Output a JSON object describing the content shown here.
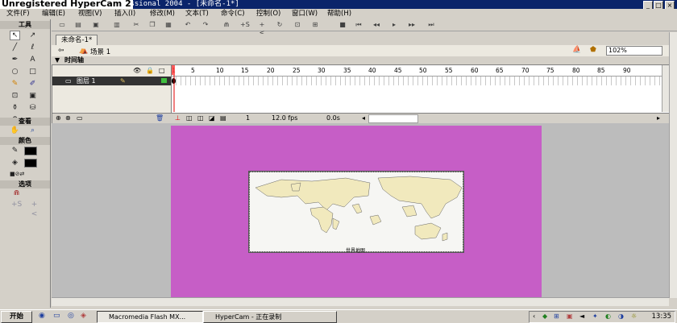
{
  "watermark": "Unregistered HyperCam 2",
  "window": {
    "title": "Macromedia Flash MX Professional 2004 - [未命名-1*]",
    "minimize": "_",
    "maximize": "□",
    "close": "×"
  },
  "menu": [
    "文件(F)",
    "编辑(E)",
    "视图(V)",
    "插入(I)",
    "修改(M)",
    "文本(T)",
    "命令(C)",
    "控制(O)",
    "窗口(W)",
    "帮助(H)"
  ],
  "tools": {
    "header": "工具",
    "view_header": "查看",
    "colors_header": "颜色",
    "options_header": "选项"
  },
  "document": {
    "tab": "未命名-1*",
    "scene": "场景 1",
    "zoom": "102%"
  },
  "timeline": {
    "header": "时间轴",
    "layer_name": "图层 1",
    "frame_numbers": [
      "1",
      "5",
      "10",
      "15",
      "20",
      "25",
      "30",
      "35",
      "40",
      "45",
      "50",
      "55",
      "60",
      "65",
      "70",
      "75",
      "80",
      "85",
      "90"
    ],
    "current_frame": "1",
    "frame_rate": "12.0 fps",
    "elapsed": "0.0s"
  },
  "stage": {
    "map_caption": "世界地图",
    "stage_color": "#c65ec6"
  },
  "taskbar": {
    "start": "开始",
    "tasks": [
      "Macromedia Flash MX...",
      "HyperCam - 正在录制"
    ],
    "clock": "13:35"
  }
}
